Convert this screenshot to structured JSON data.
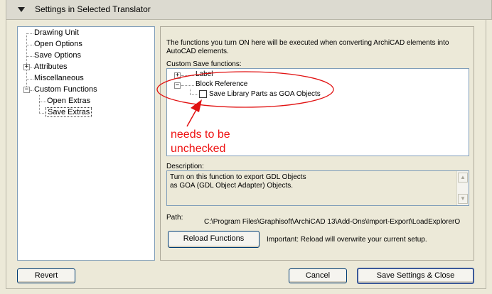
{
  "header": {
    "title": "Settings in Selected Translator"
  },
  "tree": {
    "items": [
      {
        "label": "Drawing Unit"
      },
      {
        "label": "Open Options"
      },
      {
        "label": "Save Options"
      },
      {
        "label": "Attributes",
        "expander": "+"
      },
      {
        "label": "Miscellaneous"
      },
      {
        "label": "Custom Functions",
        "expander": "−"
      },
      {
        "label": "Open Extras"
      },
      {
        "label": "Save Extras",
        "selected": true
      }
    ]
  },
  "panel": {
    "intro": "The functions you turn ON here will be executed when converting ArchiCAD elements into AutoCAD elements.",
    "custom_label": "Custom Save functions:",
    "functions": [
      {
        "label": "Label",
        "expander": "+"
      },
      {
        "label": "Block Reference",
        "expander": "−"
      },
      {
        "label": "Save Library Parts as GOA Objects",
        "checked": false
      }
    ],
    "description_label": "Description:",
    "description": "Turn on this function to export GDL Objects\nas GOA (GDL Object Adapter) Objects.",
    "path_label": "Path:",
    "path_value": "C:\\Program Files\\Graphisoft\\ArchiCAD 13\\Add-Ons\\Import-Export\\LoadExplorerO",
    "reload_button": "Reload Functions",
    "important_note": "Important: Reload will overwrite your current setup."
  },
  "annotation": {
    "line1": "needs to be",
    "line2": "unchecked",
    "color": "#e11111"
  },
  "footer": {
    "revert": "Revert",
    "cancel": "Cancel",
    "save": "Save Settings & Close"
  },
  "icons": {
    "collapse": "triangle-down-icon",
    "scroll_up": "scroll-up-icon",
    "scroll_down": "scroll-down-icon"
  }
}
